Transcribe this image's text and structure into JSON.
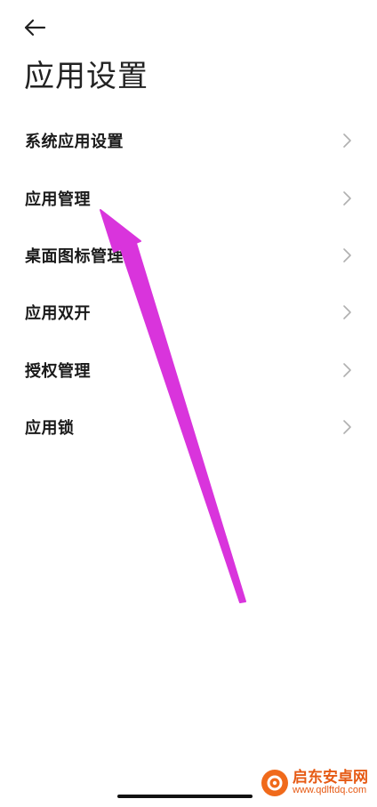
{
  "header": {
    "back_icon": "arrow-left-icon",
    "title": "应用设置"
  },
  "menu": {
    "items": [
      {
        "label": "系统应用设置",
        "icon": "chevron-right-icon"
      },
      {
        "label": "应用管理",
        "icon": "chevron-right-icon"
      },
      {
        "label": "桌面图标管理",
        "icon": "chevron-right-icon"
      },
      {
        "label": "应用双开",
        "icon": "chevron-right-icon"
      },
      {
        "label": "授权管理",
        "icon": "chevron-right-icon"
      },
      {
        "label": "应用锁",
        "icon": "chevron-right-icon"
      }
    ]
  },
  "annotation": {
    "type": "arrow",
    "color": "#d934dc"
  },
  "watermark": {
    "name": "启东安卓网",
    "url": "www.qdlftdq.com",
    "color": "#e65a14"
  },
  "colors": {
    "background": "#ffffff",
    "text": "#1a1a1a",
    "chevron": "#b0b0b0"
  }
}
